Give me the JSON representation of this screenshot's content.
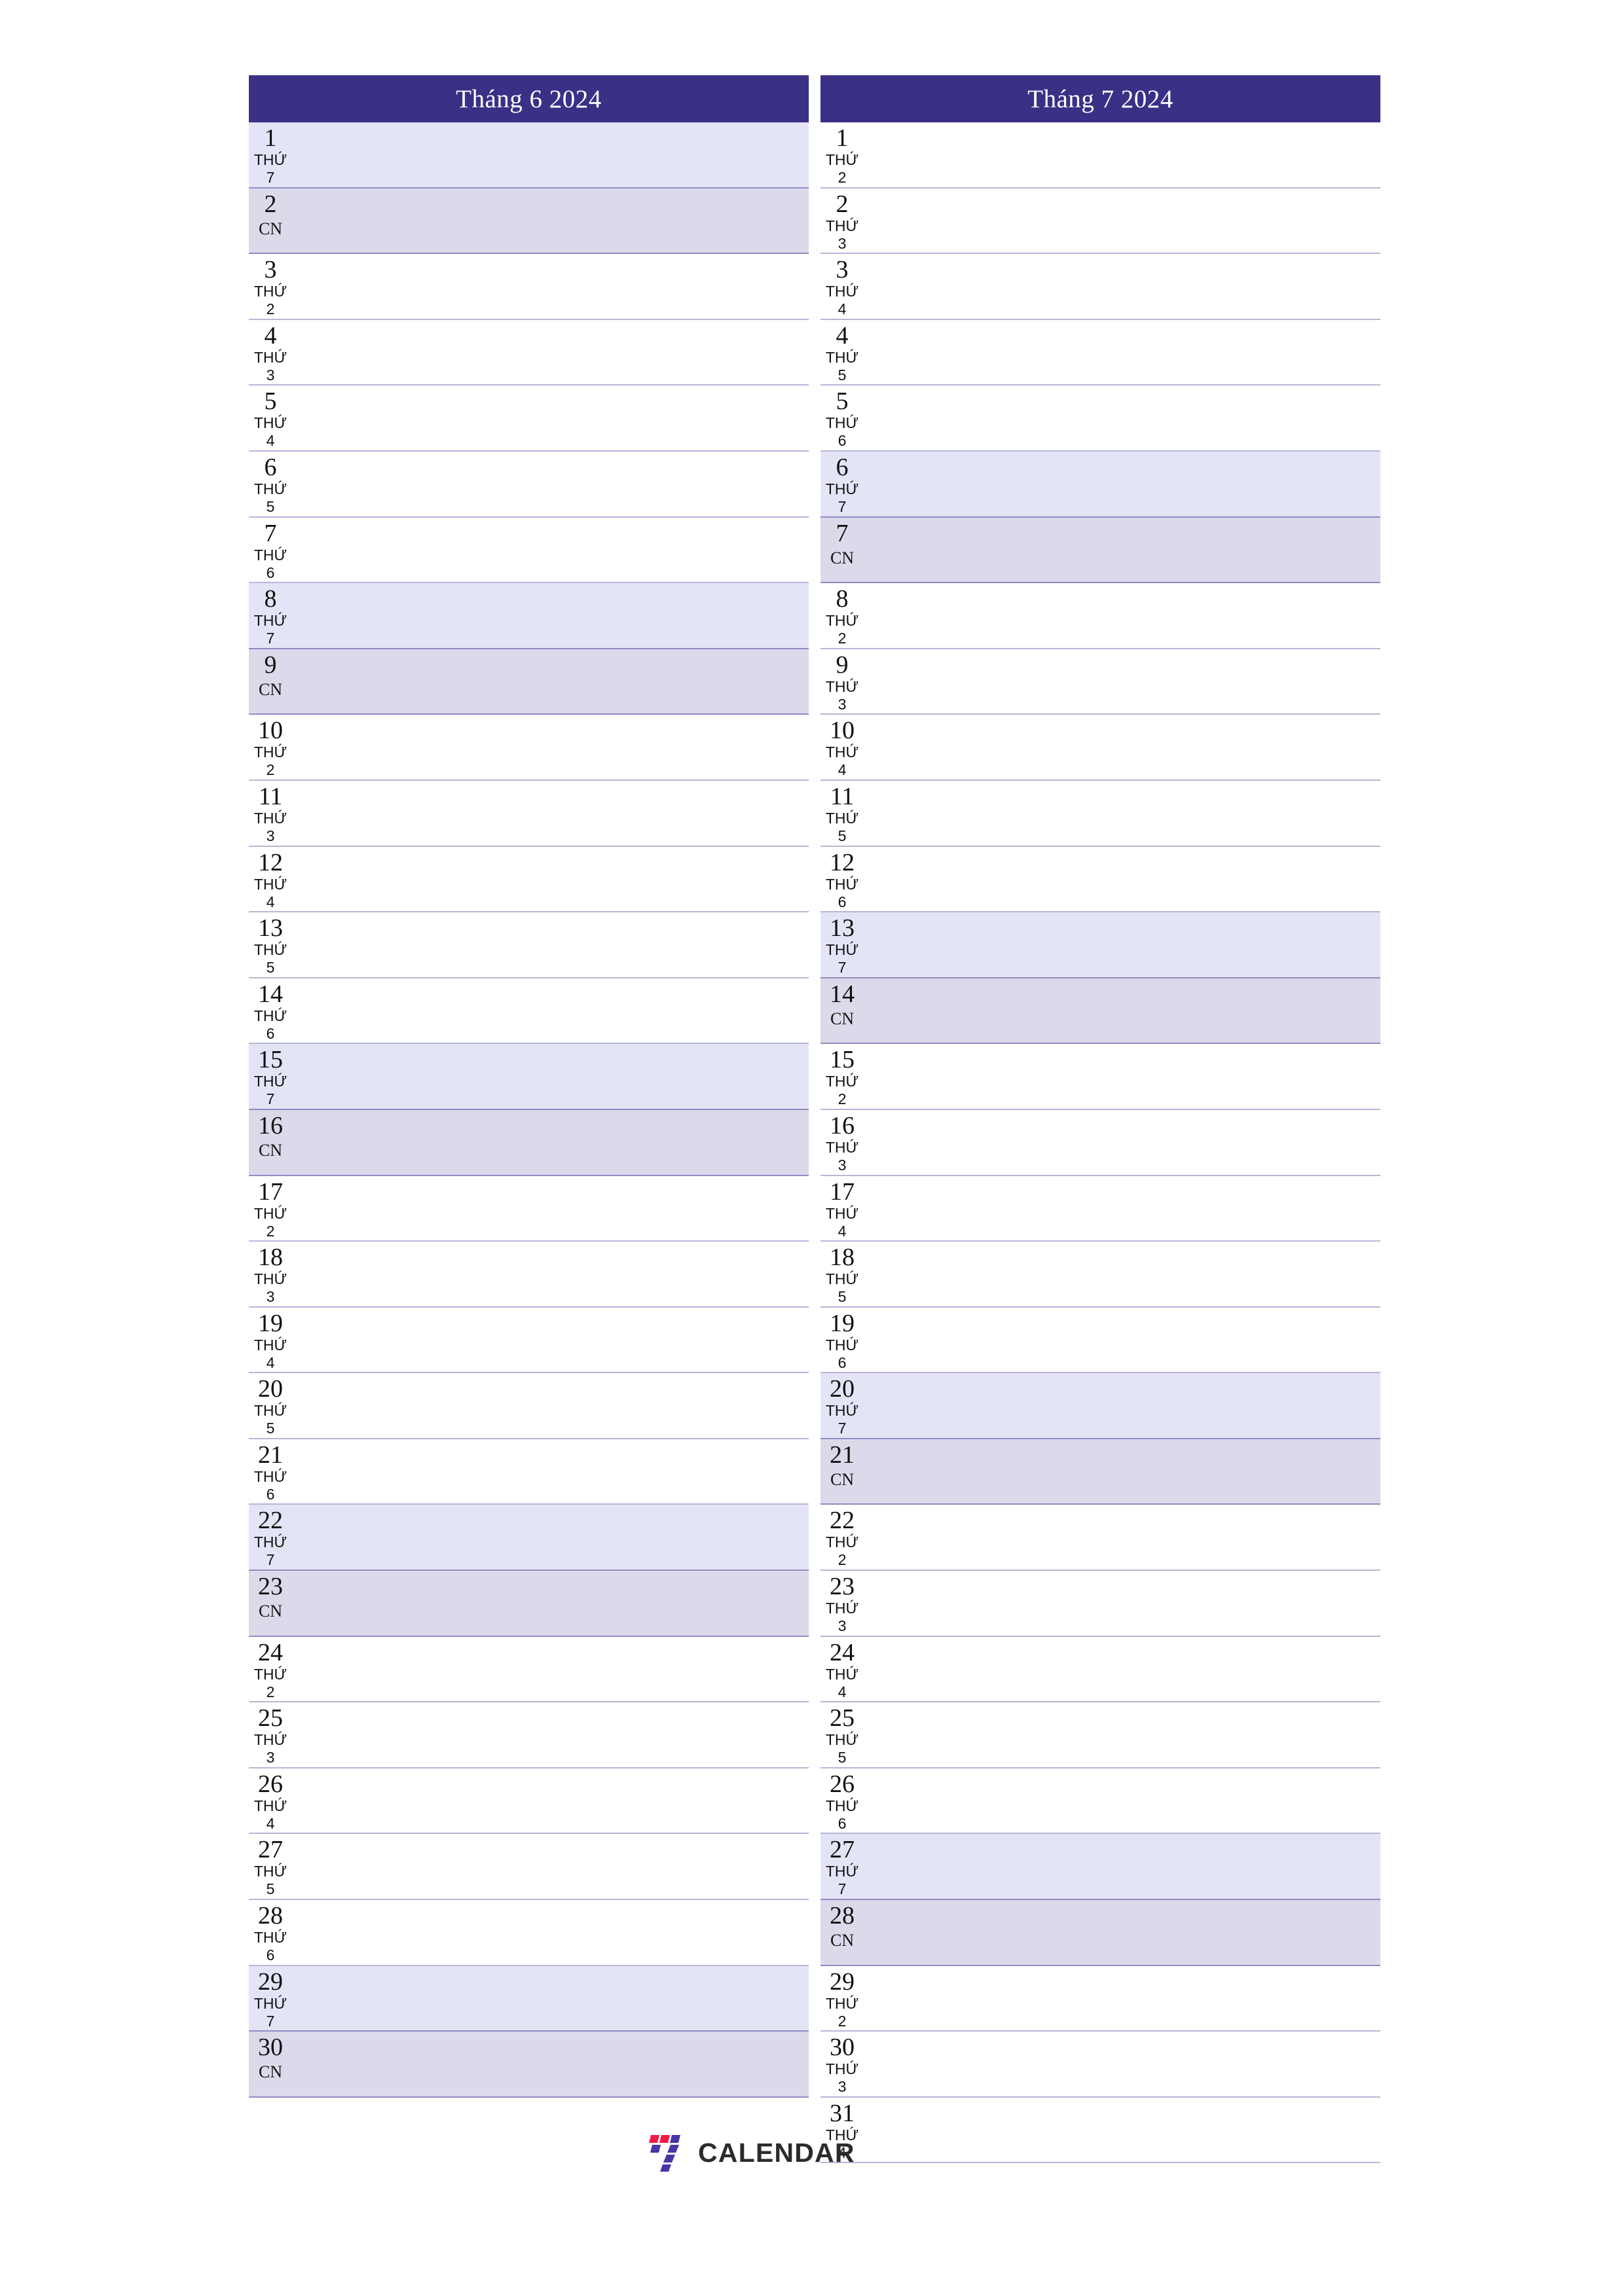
{
  "colors": {
    "header_bg": "#3a3086",
    "header_text": "#ffffff",
    "saturday_bg": "#e4e4f7",
    "sunday_bg": "#dcd9ea",
    "row_divider": "#b8b6d8",
    "weekend_divider": "#8f8cc4",
    "logo_red": "#f01b45",
    "logo_purple": "#4a34a8",
    "logo_text": "#2b2b2b",
    "page_bg": "#ffffff"
  },
  "brand": {
    "name": "CALENDAR",
    "mark": "seven-logo-icon"
  },
  "months": [
    {
      "title": "Tháng 6 2024",
      "name": "Tháng 6",
      "year": "2024",
      "days": [
        {
          "num": "1",
          "wd": "THỨ",
          "wdnum": "7",
          "type": "sat"
        },
        {
          "num": "2",
          "wd": "CN",
          "wdnum": "",
          "type": "sun"
        },
        {
          "num": "3",
          "wd": "THỨ",
          "wdnum": "2",
          "type": "weekday"
        },
        {
          "num": "4",
          "wd": "THỨ",
          "wdnum": "3",
          "type": "weekday"
        },
        {
          "num": "5",
          "wd": "THỨ",
          "wdnum": "4",
          "type": "weekday"
        },
        {
          "num": "6",
          "wd": "THỨ",
          "wdnum": "5",
          "type": "weekday"
        },
        {
          "num": "7",
          "wd": "THỨ",
          "wdnum": "6",
          "type": "weekday"
        },
        {
          "num": "8",
          "wd": "THỨ",
          "wdnum": "7",
          "type": "sat"
        },
        {
          "num": "9",
          "wd": "CN",
          "wdnum": "",
          "type": "sun"
        },
        {
          "num": "10",
          "wd": "THỨ",
          "wdnum": "2",
          "type": "weekday"
        },
        {
          "num": "11",
          "wd": "THỨ",
          "wdnum": "3",
          "type": "weekday"
        },
        {
          "num": "12",
          "wd": "THỨ",
          "wdnum": "4",
          "type": "weekday"
        },
        {
          "num": "13",
          "wd": "THỨ",
          "wdnum": "5",
          "type": "weekday"
        },
        {
          "num": "14",
          "wd": "THỨ",
          "wdnum": "6",
          "type": "weekday"
        },
        {
          "num": "15",
          "wd": "THỨ",
          "wdnum": "7",
          "type": "sat"
        },
        {
          "num": "16",
          "wd": "CN",
          "wdnum": "",
          "type": "sun"
        },
        {
          "num": "17",
          "wd": "THỨ",
          "wdnum": "2",
          "type": "weekday"
        },
        {
          "num": "18",
          "wd": "THỨ",
          "wdnum": "3",
          "type": "weekday"
        },
        {
          "num": "19",
          "wd": "THỨ",
          "wdnum": "4",
          "type": "weekday"
        },
        {
          "num": "20",
          "wd": "THỨ",
          "wdnum": "5",
          "type": "weekday"
        },
        {
          "num": "21",
          "wd": "THỨ",
          "wdnum": "6",
          "type": "weekday"
        },
        {
          "num": "22",
          "wd": "THỨ",
          "wdnum": "7",
          "type": "sat"
        },
        {
          "num": "23",
          "wd": "CN",
          "wdnum": "",
          "type": "sun"
        },
        {
          "num": "24",
          "wd": "THỨ",
          "wdnum": "2",
          "type": "weekday"
        },
        {
          "num": "25",
          "wd": "THỨ",
          "wdnum": "3",
          "type": "weekday"
        },
        {
          "num": "26",
          "wd": "THỨ",
          "wdnum": "4",
          "type": "weekday"
        },
        {
          "num": "27",
          "wd": "THỨ",
          "wdnum": "5",
          "type": "weekday"
        },
        {
          "num": "28",
          "wd": "THỨ",
          "wdnum": "6",
          "type": "weekday"
        },
        {
          "num": "29",
          "wd": "THỨ",
          "wdnum": "7",
          "type": "sat"
        },
        {
          "num": "30",
          "wd": "CN",
          "wdnum": "",
          "type": "sun"
        }
      ]
    },
    {
      "title": "Tháng 7 2024",
      "name": "Tháng 7",
      "year": "2024",
      "days": [
        {
          "num": "1",
          "wd": "THỨ",
          "wdnum": "2",
          "type": "weekday"
        },
        {
          "num": "2",
          "wd": "THỨ",
          "wdnum": "3",
          "type": "weekday"
        },
        {
          "num": "3",
          "wd": "THỨ",
          "wdnum": "4",
          "type": "weekday"
        },
        {
          "num": "4",
          "wd": "THỨ",
          "wdnum": "5",
          "type": "weekday"
        },
        {
          "num": "5",
          "wd": "THỨ",
          "wdnum": "6",
          "type": "weekday"
        },
        {
          "num": "6",
          "wd": "THỨ",
          "wdnum": "7",
          "type": "sat"
        },
        {
          "num": "7",
          "wd": "CN",
          "wdnum": "",
          "type": "sun"
        },
        {
          "num": "8",
          "wd": "THỨ",
          "wdnum": "2",
          "type": "weekday"
        },
        {
          "num": "9",
          "wd": "THỨ",
          "wdnum": "3",
          "type": "weekday"
        },
        {
          "num": "10",
          "wd": "THỨ",
          "wdnum": "4",
          "type": "weekday"
        },
        {
          "num": "11",
          "wd": "THỨ",
          "wdnum": "5",
          "type": "weekday"
        },
        {
          "num": "12",
          "wd": "THỨ",
          "wdnum": "6",
          "type": "weekday"
        },
        {
          "num": "13",
          "wd": "THỨ",
          "wdnum": "7",
          "type": "sat"
        },
        {
          "num": "14",
          "wd": "CN",
          "wdnum": "",
          "type": "sun"
        },
        {
          "num": "15",
          "wd": "THỨ",
          "wdnum": "2",
          "type": "weekday"
        },
        {
          "num": "16",
          "wd": "THỨ",
          "wdnum": "3",
          "type": "weekday"
        },
        {
          "num": "17",
          "wd": "THỨ",
          "wdnum": "4",
          "type": "weekday"
        },
        {
          "num": "18",
          "wd": "THỨ",
          "wdnum": "5",
          "type": "weekday"
        },
        {
          "num": "19",
          "wd": "THỨ",
          "wdnum": "6",
          "type": "weekday"
        },
        {
          "num": "20",
          "wd": "THỨ",
          "wdnum": "7",
          "type": "sat"
        },
        {
          "num": "21",
          "wd": "CN",
          "wdnum": "",
          "type": "sun"
        },
        {
          "num": "22",
          "wd": "THỨ",
          "wdnum": "2",
          "type": "weekday"
        },
        {
          "num": "23",
          "wd": "THỨ",
          "wdnum": "3",
          "type": "weekday"
        },
        {
          "num": "24",
          "wd": "THỨ",
          "wdnum": "4",
          "type": "weekday"
        },
        {
          "num": "25",
          "wd": "THỨ",
          "wdnum": "5",
          "type": "weekday"
        },
        {
          "num": "26",
          "wd": "THỨ",
          "wdnum": "6",
          "type": "weekday"
        },
        {
          "num": "27",
          "wd": "THỨ",
          "wdnum": "7",
          "type": "sat"
        },
        {
          "num": "28",
          "wd": "CN",
          "wdnum": "",
          "type": "sun"
        },
        {
          "num": "29",
          "wd": "THỨ",
          "wdnum": "2",
          "type": "weekday"
        },
        {
          "num": "30",
          "wd": "THỨ",
          "wdnum": "3",
          "type": "weekday"
        },
        {
          "num": "31",
          "wd": "THỨ",
          "wdnum": "4",
          "type": "weekday"
        }
      ]
    }
  ]
}
